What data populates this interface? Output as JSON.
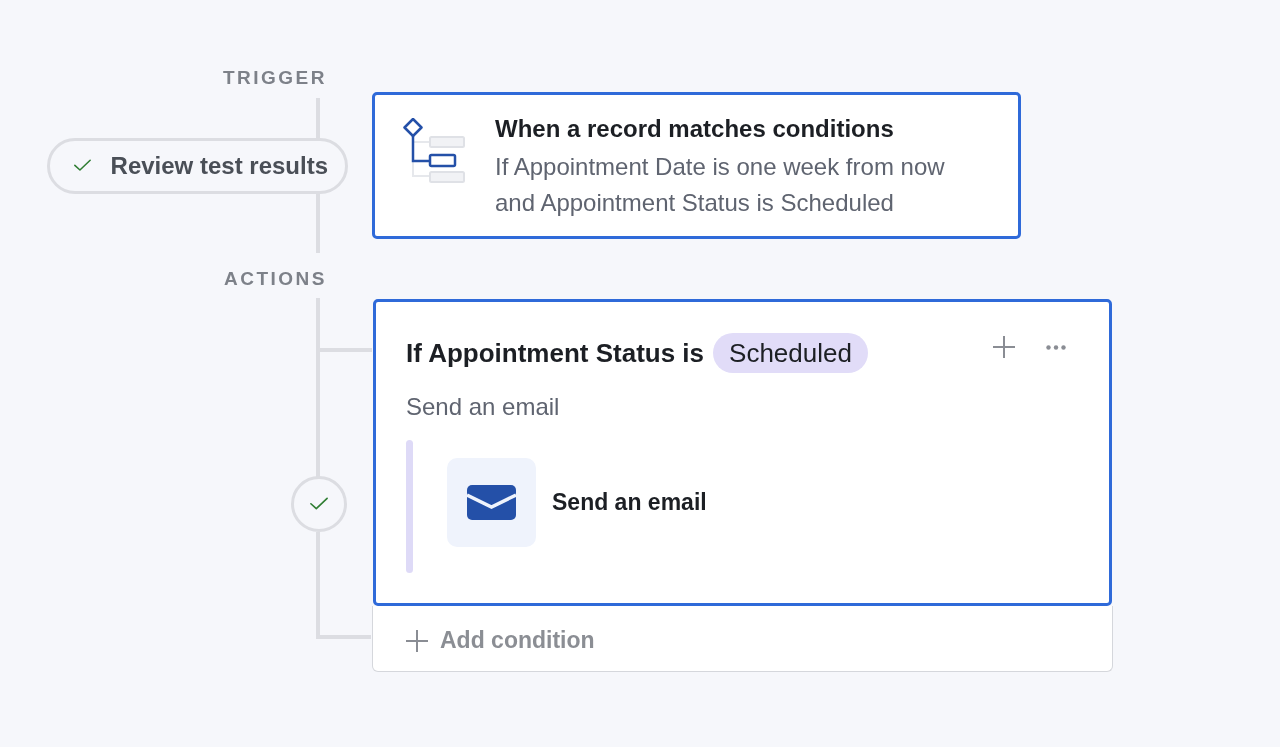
{
  "trigger": {
    "label": "TRIGGER",
    "review_button": {
      "label": "Review test results"
    },
    "card": {
      "selected": true,
      "title": "When a record matches conditions",
      "description": "If Appointment Date is one week from now and Appointment Status is Scheduled"
    }
  },
  "actions": {
    "label": "ACTIONS",
    "step_passed": true,
    "condition": {
      "selected": true,
      "title": "If Appointment Status is",
      "value": "Scheduled",
      "subtitle": "Send an email",
      "steps": [
        {
          "kind": "email",
          "label": "Send an email"
        }
      ]
    },
    "add_condition": {
      "label": "Add condition"
    }
  }
}
